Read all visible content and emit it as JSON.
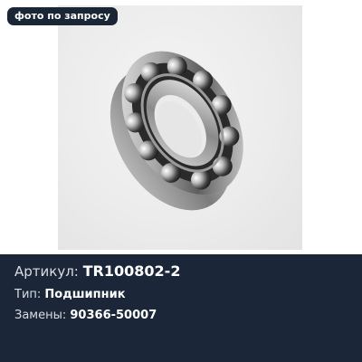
{
  "badge": {
    "label": "фото по запросу"
  },
  "image": {
    "subject": "ball-bearing"
  },
  "info": {
    "article_label": "Артикул:",
    "article_value": "TR100802-2",
    "type_label": "Тип:",
    "type_value": "Подшипник",
    "replacements_label": "Замены:",
    "replacements_value": "90366-50007"
  },
  "colors": {
    "panel": "#1b2738",
    "badge": "#1a2535",
    "text": "#ffffff"
  }
}
